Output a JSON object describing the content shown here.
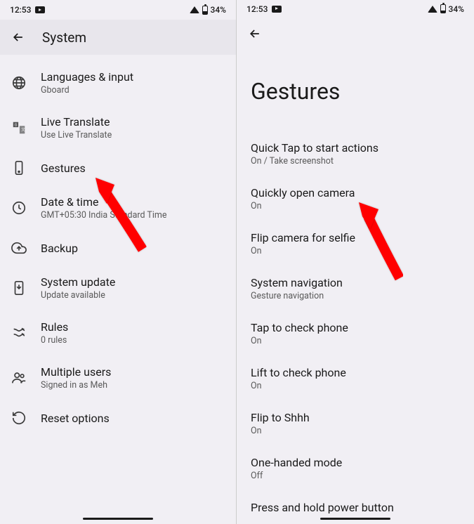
{
  "left": {
    "status": {
      "time": "12:53",
      "battery": "34%"
    },
    "header": {
      "title": "System"
    },
    "items": [
      {
        "label": "Languages & input",
        "sublabel": "Gboard",
        "icon": "globe-icon"
      },
      {
        "label": "Live Translate",
        "sublabel": "Use Live Translate",
        "icon": "translate-icon"
      },
      {
        "label": "Gestures",
        "sublabel": "",
        "icon": "touch-icon"
      },
      {
        "label": "Date & time",
        "sublabel": "GMT+05:30 India Standard Time",
        "icon": "clock-icon"
      },
      {
        "label": "Backup",
        "sublabel": "",
        "icon": "backup-icon"
      },
      {
        "label": "System update",
        "sublabel": "Update available",
        "icon": "update-icon"
      },
      {
        "label": "Rules",
        "sublabel": "0 rules",
        "icon": "rules-icon"
      },
      {
        "label": "Multiple users",
        "sublabel": "Signed in as Meh",
        "icon": "users-icon"
      },
      {
        "label": "Reset options",
        "sublabel": "",
        "icon": "reset-icon"
      }
    ]
  },
  "right": {
    "status": {
      "time": "12:53",
      "battery": "34%"
    },
    "pageTitle": "Gestures",
    "items": [
      {
        "label": "Quick Tap to start actions",
        "sublabel": "On / Take screenshot"
      },
      {
        "label": "Quickly open camera",
        "sublabel": "On"
      },
      {
        "label": "Flip camera for selfie",
        "sublabel": "On"
      },
      {
        "label": "System navigation",
        "sublabel": "Gesture navigation"
      },
      {
        "label": "Tap to check phone",
        "sublabel": "On"
      },
      {
        "label": "Lift to check phone",
        "sublabel": "On"
      },
      {
        "label": "Flip to Shhh",
        "sublabel": "On"
      },
      {
        "label": "One-handed mode",
        "sublabel": "Off"
      },
      {
        "label": "Press and hold power button",
        "sublabel": ""
      }
    ]
  }
}
